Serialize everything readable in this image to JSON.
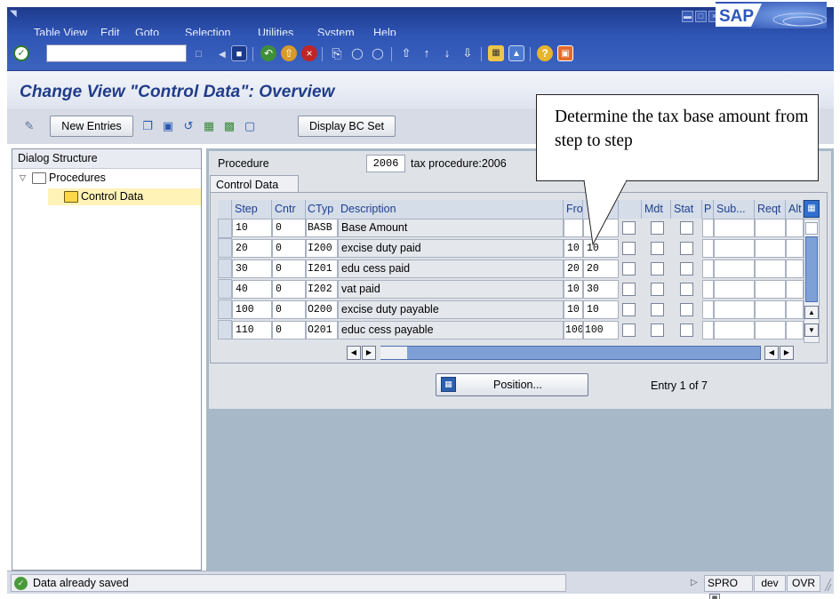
{
  "menubar": {
    "items": [
      {
        "label": "Table View"
      },
      {
        "label": "Edit"
      },
      {
        "label": "Goto"
      },
      {
        "label": "Selection"
      },
      {
        "label": "Utilities"
      },
      {
        "label": "System"
      },
      {
        "label": "Help"
      }
    ],
    "logo": "SAP"
  },
  "toolbar": {
    "command_field": "",
    "icons": [
      "back-icon",
      "exit-icon",
      "cancel-icon",
      "print-icon",
      "find-icon",
      "find-next-icon",
      "first-page-icon",
      "previous-page-icon",
      "next-page-icon",
      "last-page-icon",
      "new-session-icon",
      "shortcut-icon",
      "help-icon",
      "layout-icon"
    ]
  },
  "screen": {
    "title": "Change View \"Control Data\": Overview"
  },
  "app_toolbar": {
    "new_entries_label": "New Entries",
    "display_bc_set_label": "Display BC Set"
  },
  "tree": {
    "header": "Dialog Structure",
    "procedures_label": "Procedures",
    "control_data_label": "Control Data"
  },
  "procedure": {
    "label": "Procedure",
    "value": "2006",
    "description": "tax procedure:2006"
  },
  "tab": {
    "label": "Control Data"
  },
  "table": {
    "columns": [
      "Step",
      "Cntr",
      "CTyp",
      "Description",
      "Fro",
      "",
      "",
      "Mdt",
      "Stat",
      "P",
      "Sub...",
      "Reqt",
      "Alt"
    ],
    "rows": [
      {
        "step": "10",
        "cntr": "0",
        "ctyp": "BASB",
        "description": "Base Amount",
        "from": "",
        "to": ""
      },
      {
        "step": "20",
        "cntr": "0",
        "ctyp": "I200",
        "description": "excise duty paid",
        "from": "10",
        "to": "10"
      },
      {
        "step": "30",
        "cntr": "0",
        "ctyp": "I201",
        "description": "edu cess paid",
        "from": "20",
        "to": "20"
      },
      {
        "step": "40",
        "cntr": "0",
        "ctyp": "I202",
        "description": "vat paid",
        "from": "10",
        "to": "30"
      },
      {
        "step": "100",
        "cntr": "0",
        "ctyp": "O200",
        "description": "excise duty payable",
        "from": "10",
        "to": "10"
      },
      {
        "step": "110",
        "cntr": "0",
        "ctyp": "O201",
        "description": "educ cess payable",
        "from": "100",
        "to": "100"
      }
    ]
  },
  "position": {
    "button_label": "Position...",
    "entry_text": "Entry 1 of 7"
  },
  "callout": {
    "text": "Determine the tax base amount from step to step"
  },
  "status": {
    "message": "Data already saved",
    "transaction": "SPRO",
    "system": "dev",
    "mode": "OVR"
  }
}
